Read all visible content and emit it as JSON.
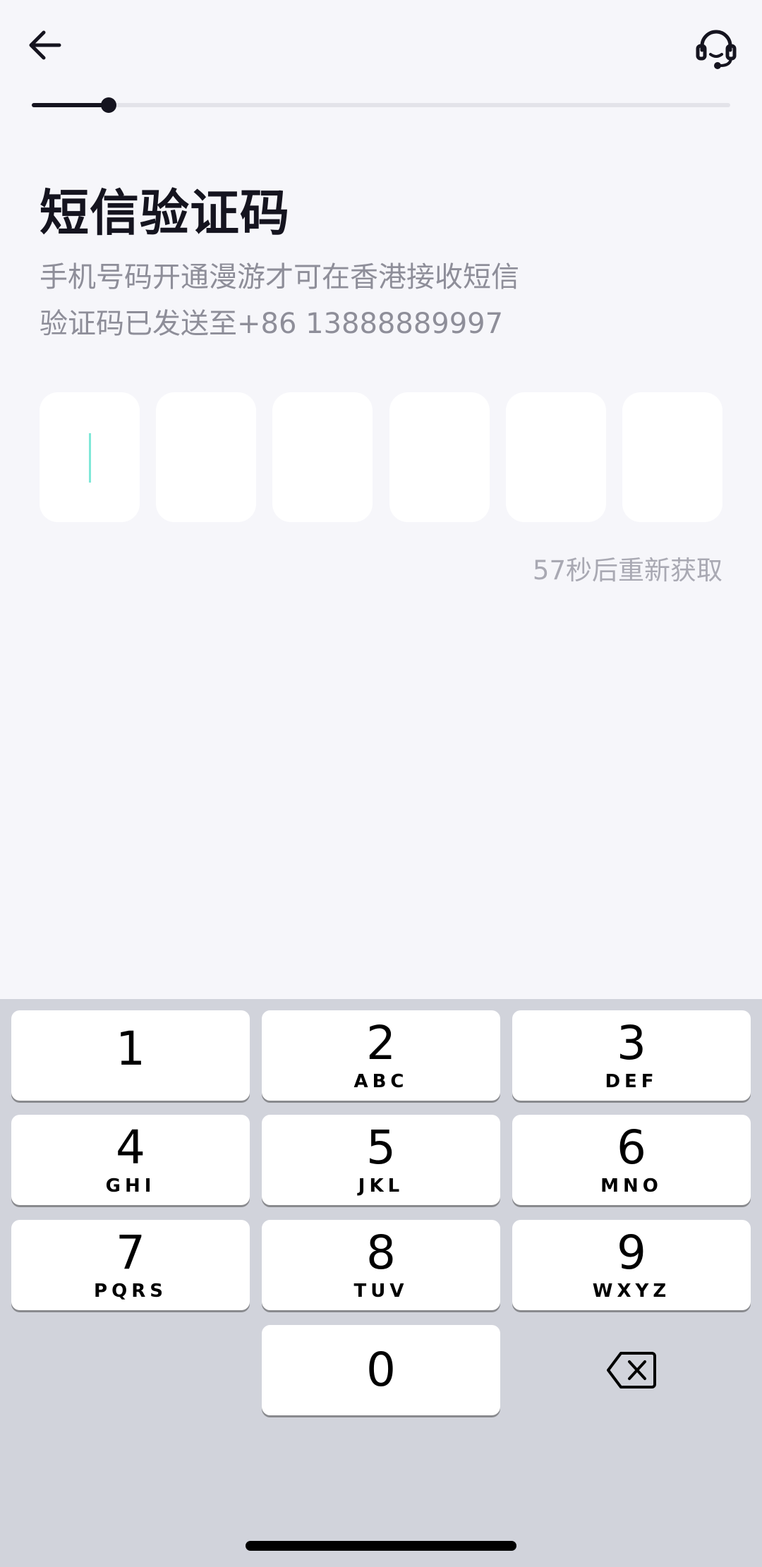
{
  "header": {
    "back_icon": "arrow-left-icon",
    "support_icon": "headset-icon"
  },
  "progress": {
    "fraction": 0.11
  },
  "title": "短信验证码",
  "subtitle_line1": "手机号码开通漫游才可在香港接收短信",
  "subtitle_line2": "验证码已发送至+86 13888889997",
  "code_boxes": [
    "",
    "",
    "",
    "",
    "",
    ""
  ],
  "resend_text": "57秒后重新获取",
  "keypad": {
    "keys": [
      {
        "digit": "1",
        "letters": ""
      },
      {
        "digit": "2",
        "letters": "ABC"
      },
      {
        "digit": "3",
        "letters": "DEF"
      },
      {
        "digit": "4",
        "letters": "GHI"
      },
      {
        "digit": "5",
        "letters": "JKL"
      },
      {
        "digit": "6",
        "letters": "MNO"
      },
      {
        "digit": "7",
        "letters": "PQRS"
      },
      {
        "digit": "8",
        "letters": "TUV"
      },
      {
        "digit": "9",
        "letters": "WXYZ"
      },
      {
        "digit": "0",
        "letters": ""
      }
    ],
    "delete_icon": "backspace-icon"
  }
}
